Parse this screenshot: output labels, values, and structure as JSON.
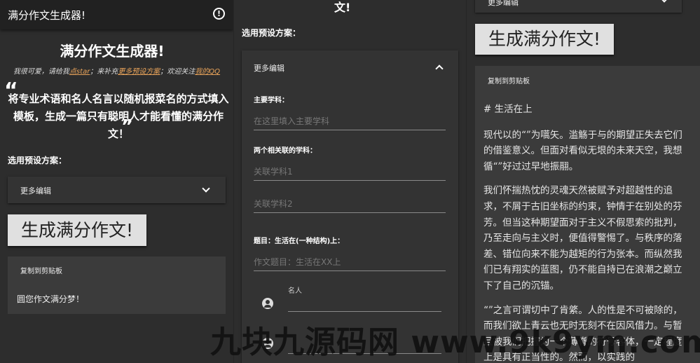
{
  "panel1": {
    "appbar_title": "满分作文生成器!",
    "heading": "满分作文生成器!",
    "subline": {
      "t1": "我很可爱，请给我",
      "l1": "点star",
      "t2": "；来补充",
      "l2": "更多预设方案",
      "t3": "；欢迎关注",
      "l3": "我的QQ"
    },
    "quote_open": "“",
    "quote_close": "”",
    "quote_text": "将专业术语和名人名言以随机报菜名的方式填入模板，生成一篇只有聪明人才能看懂的满分作文！",
    "preset_label": "选用预设方案：",
    "expander_title": "更多编辑",
    "generate_button": "生成满分作文!",
    "copy_label": "复制到剪贴板",
    "output_text": "圆您作文满分梦！"
  },
  "panel2": {
    "top_cut": "文!",
    "preset_label": "选用预设方案：",
    "expander_title": "更多编辑",
    "subject_label": "主要学科：",
    "subject_placeholder": "在这里填入主要学科",
    "related_label": "两个相关联的学科：",
    "related1_placeholder": "关联学科1",
    "related2_placeholder": "关联学科2",
    "topic_label": "题目：生活在(一种结构)上：",
    "topic_placeholder": "作文题目：生活在XX上",
    "person_label": "名人"
  },
  "panel3": {
    "top_cut": "更多编辑",
    "generate_button": "生成满分作文!",
    "copy_label": "复制到剪贴板",
    "article_title": "# 生活在上",
    "paragraphs": [
      "现代以的“”为嚆矢。滥觞于与的期望正失去它们的借鉴意义。但面对看似无垠的未来天空，我想循“”好过过早地振翮。",
      "我们怀揣热忱的灵魂天然被赋予对超越性的追求，不屑于古旧坐标的约束，钟情于在别处的芬芳。但当这种期望面对于主义不假思索的批判，乃至走向与主义时，便值得警惕了。与秩序的落差、错位向来不能为越矩的行为张本。而纵然我们已有翔实的蓝图，仍不能自持已在浪潮之巅立下了自己的沉锚。",
      "“”之言可谓切中了肯綮。人的性是不可被除的，而我们欲上青云也无时无刻不在因风借力。与暂且被我们把握为一个薄脊的符号客体，一定程度上是具有正当性的。然而，以实践的"
    ]
  },
  "watermark": "九块九源码网 www.9k9ym.com"
}
